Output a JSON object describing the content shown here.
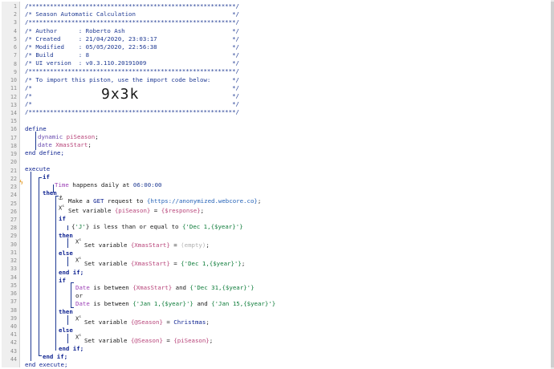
{
  "header_comments": [
    "/**********************************************************/",
    "/* Season Automatic Calculation                           */",
    "/**********************************************************/",
    "/* Author      : Roberto Ash                              */",
    "/* Created     : 21/04/2020, 23:03:17                     */",
    "/* Modified    : 05/05/2020, 22:56:38                     */",
    "/* Build       : 8                                        */",
    "/* UI version  : v0.3.110.20191009                        */",
    "/**********************************************************/",
    "/* To import this piston, use the import code below:      */",
    "/*                                                        */",
    "/*                                                        */",
    "/*                                                        */",
    "/**********************************************************/"
  ],
  "import_code": "9x3k",
  "define": {
    "keyword": "define",
    "vars": [
      {
        "type": "dynamic",
        "name": "piSeason"
      },
      {
        "type": "date",
        "name": "XmasStart"
      }
    ],
    "end": "end define;"
  },
  "execute": {
    "keyword": "execute",
    "if1": "if",
    "trigger": {
      "device": "Time",
      "text": " happens daily at ",
      "time": "06:00:00"
    },
    "then": "then",
    "get_request": {
      "prefix": "Make a ",
      "method": "GET",
      "mid": " request to ",
      "url": "{https://anonymized.webcore.co}",
      "suffix": ";"
    },
    "set_pi": {
      "prefix": "Set variable ",
      "var": "{piSeason}",
      "eq": " = ",
      "val": "{$response}",
      "suffix": ";"
    },
    "if2": "if",
    "cond_j": {
      "open": "{",
      "str": "'J'",
      "close": "}",
      "text": " is less than or equal to ",
      "val": "{'Dec 1,{$year}'}"
    },
    "then2": "then",
    "set_x_empty": {
      "prefix": "Set variable ",
      "var": "{XmasStart}",
      "eq": " = ",
      "val": "(empty)",
      "suffix": ";"
    },
    "else1": "else",
    "set_x_dec": {
      "prefix": "Set variable ",
      "var": "{XmasStart}",
      "eq": " = ",
      "val": "{'Dec 1,{$year}'}",
      "suffix": ";"
    },
    "endif1": "end if;",
    "if3": "if",
    "cond_date1": {
      "dev": "Date",
      "text": " is between ",
      "a": "{XmasStart}",
      "and": " and ",
      "b": "{'Dec 31,{$year}'}"
    },
    "or": "or",
    "cond_date2": {
      "dev": "Date",
      "text": " is between ",
      "a": "{'Jan 1,{$year}'}",
      "and": " and ",
      "b": "{'Jan 15,{$year}'}"
    },
    "then3": "then",
    "set_season_x": {
      "prefix": "Set variable ",
      "var": "{@Season}",
      "eq": " = ",
      "val": "Christmas",
      "suffix": ";"
    },
    "else2": "else",
    "set_season_pi": {
      "prefix": "Set variable ",
      "var": "{@Season}",
      "eq": " = ",
      "val": "{piSeason}",
      "suffix": ";"
    },
    "endif2": "end if;",
    "endif3": "end if;",
    "end": "end execute;"
  },
  "line_numbers": [
    "1",
    "2",
    "3",
    "4",
    "5",
    "6",
    "7",
    "8",
    "9",
    "10",
    "11",
    "12",
    "13",
    "14",
    "15",
    "16",
    "17",
    "18",
    "19",
    "20",
    "21",
    "22",
    "23",
    "24",
    "25",
    "26",
    "27",
    "28",
    "29",
    "30",
    "31",
    "32",
    "33",
    "34",
    "35",
    "36",
    "37",
    "38",
    "39",
    "40",
    "41",
    "42",
    "43",
    "44"
  ]
}
